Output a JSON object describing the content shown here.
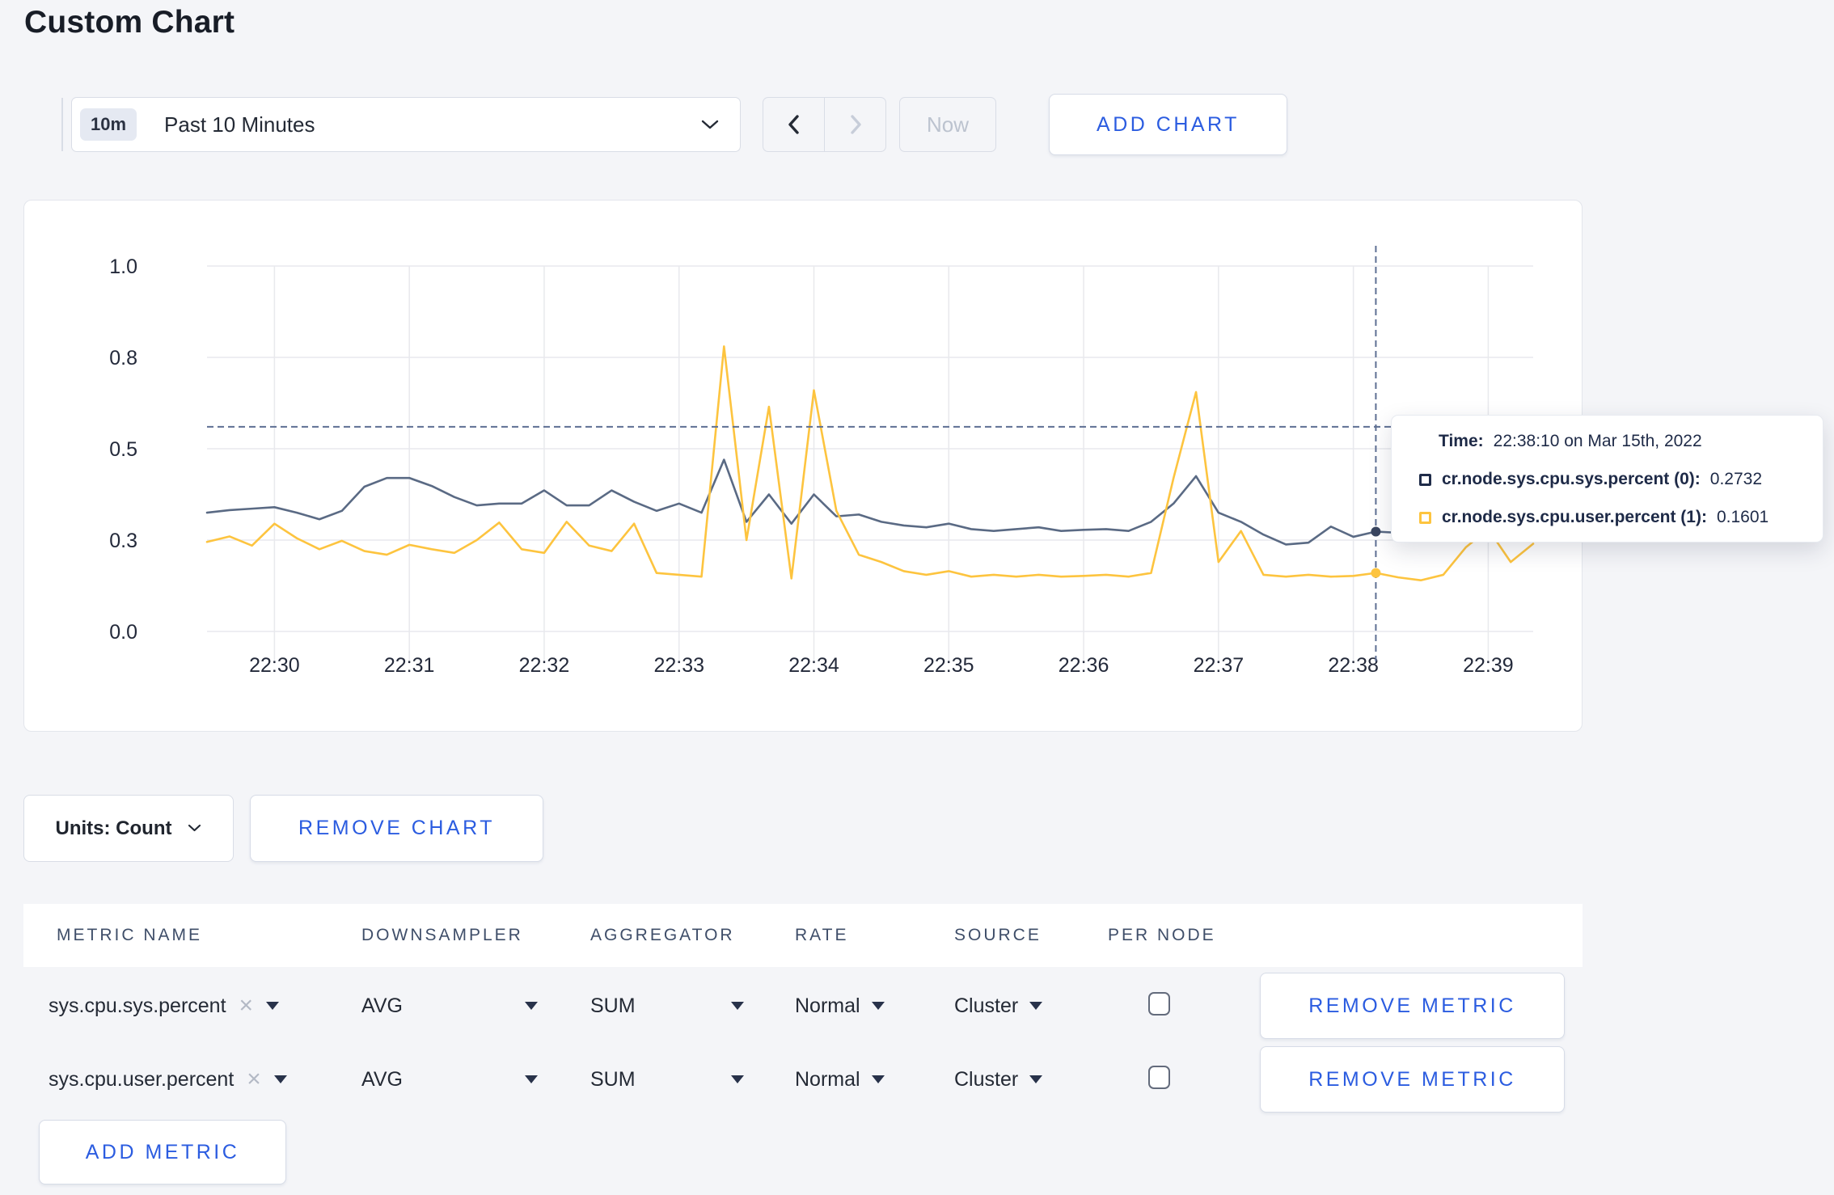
{
  "page": {
    "title": "Custom Chart",
    "background_color": "#f4f5f8",
    "accent_blue": "#2b5ce0"
  },
  "toolbar": {
    "time_range": {
      "badge": "10m",
      "label": "Past 10 Minutes",
      "icon": "chevron-down-icon"
    },
    "prev_icon": "chevron-left-icon",
    "next_icon": "chevron-right-icon",
    "now_label": "Now",
    "add_chart_label": "ADD CHART"
  },
  "chart_data": {
    "type": "line",
    "title": "",
    "xlabel": "",
    "ylabel": "",
    "x_start": "22:29:30",
    "x_interval_seconds": 10,
    "x_tick_labels": [
      "22:30",
      "22:31",
      "22:32",
      "22:33",
      "22:34",
      "22:35",
      "22:36",
      "22:37",
      "22:38",
      "22:39"
    ],
    "ylim": [
      0,
      1
    ],
    "y_ticks": [
      {
        "value": 0,
        "label": "0.0"
      },
      {
        "value": 0.25,
        "label": "0.3"
      },
      {
        "value": 0.5,
        "label": "0.5"
      },
      {
        "value": 0.75,
        "label": "0.8"
      },
      {
        "value": 1.0,
        "label": "1.0"
      }
    ],
    "grid": true,
    "legend_position": "tooltip",
    "series": [
      {
        "name": "cr.node.sys.cpu.sys.percent (0)",
        "color": "#5a6a84",
        "dot_color": "#3a4660",
        "values": [
          0.325,
          0.332,
          0.336,
          0.34,
          0.325,
          0.307,
          0.33,
          0.396,
          0.42,
          0.42,
          0.398,
          0.368,
          0.345,
          0.35,
          0.35,
          0.386,
          0.345,
          0.345,
          0.386,
          0.355,
          0.33,
          0.35,
          0.325,
          0.47,
          0.3,
          0.375,
          0.295,
          0.375,
          0.315,
          0.32,
          0.3,
          0.29,
          0.285,
          0.295,
          0.28,
          0.275,
          0.28,
          0.285,
          0.275,
          0.278,
          0.28,
          0.275,
          0.3,
          0.35,
          0.425,
          0.325,
          0.3,
          0.265,
          0.238,
          0.243,
          0.287,
          0.259,
          0.2732,
          0.27,
          0.265,
          0.27,
          0.265,
          0.27,
          0.265,
          0.27
        ]
      },
      {
        "name": "cr.node.sys.cpu.user.percent (1)",
        "color": "#fdc43f",
        "dot_color": "#fdc43f",
        "values": [
          0.245,
          0.26,
          0.235,
          0.295,
          0.255,
          0.225,
          0.248,
          0.22,
          0.21,
          0.237,
          0.225,
          0.215,
          0.25,
          0.298,
          0.225,
          0.215,
          0.3,
          0.235,
          0.22,
          0.295,
          0.16,
          0.155,
          0.15,
          0.78,
          0.25,
          0.615,
          0.145,
          0.66,
          0.33,
          0.21,
          0.19,
          0.165,
          0.155,
          0.165,
          0.15,
          0.155,
          0.15,
          0.155,
          0.15,
          0.152,
          0.155,
          0.15,
          0.16,
          0.42,
          0.655,
          0.19,
          0.275,
          0.155,
          0.15,
          0.155,
          0.15,
          0.152,
          0.1601,
          0.148,
          0.14,
          0.155,
          0.23,
          0.28,
          0.19,
          0.24
        ]
      }
    ],
    "hover": {
      "time": "22:38:10",
      "offset_seconds": 520,
      "crosshair_y_value": 0.56,
      "values": [
        0.2732,
        0.1601
      ]
    }
  },
  "tooltip": {
    "time_label": "Time:",
    "time_value": "22:38:10 on Mar 15th, 2022",
    "rows": [
      {
        "label": "cr.node.sys.cpu.sys.percent (0):",
        "value": "0.2732",
        "swatch_color": "#1f2c49"
      },
      {
        "label": "cr.node.sys.cpu.user.percent (1):",
        "value": "0.1601",
        "swatch_color": "#fdc43f"
      }
    ]
  },
  "units_bar": {
    "units_label": "Units: Count",
    "units_icon": "chevron-down-icon",
    "remove_chart_label": "REMOVE CHART"
  },
  "metrics_table": {
    "headers": [
      "METRIC NAME",
      "DOWNSAMPLER",
      "AGGREGATOR",
      "RATE",
      "SOURCE",
      "PER NODE"
    ],
    "rows": [
      {
        "metric": "sys.cpu.sys.percent",
        "downsampler": "AVG",
        "aggregator": "SUM",
        "rate": "Normal",
        "source": "Cluster",
        "per_node_checked": false,
        "remove_label": "REMOVE METRIC"
      },
      {
        "metric": "sys.cpu.user.percent",
        "downsampler": "AVG",
        "aggregator": "SUM",
        "rate": "Normal",
        "source": "Cluster",
        "per_node_checked": false,
        "remove_label": "REMOVE METRIC"
      }
    ],
    "add_metric_label": "ADD METRIC"
  }
}
